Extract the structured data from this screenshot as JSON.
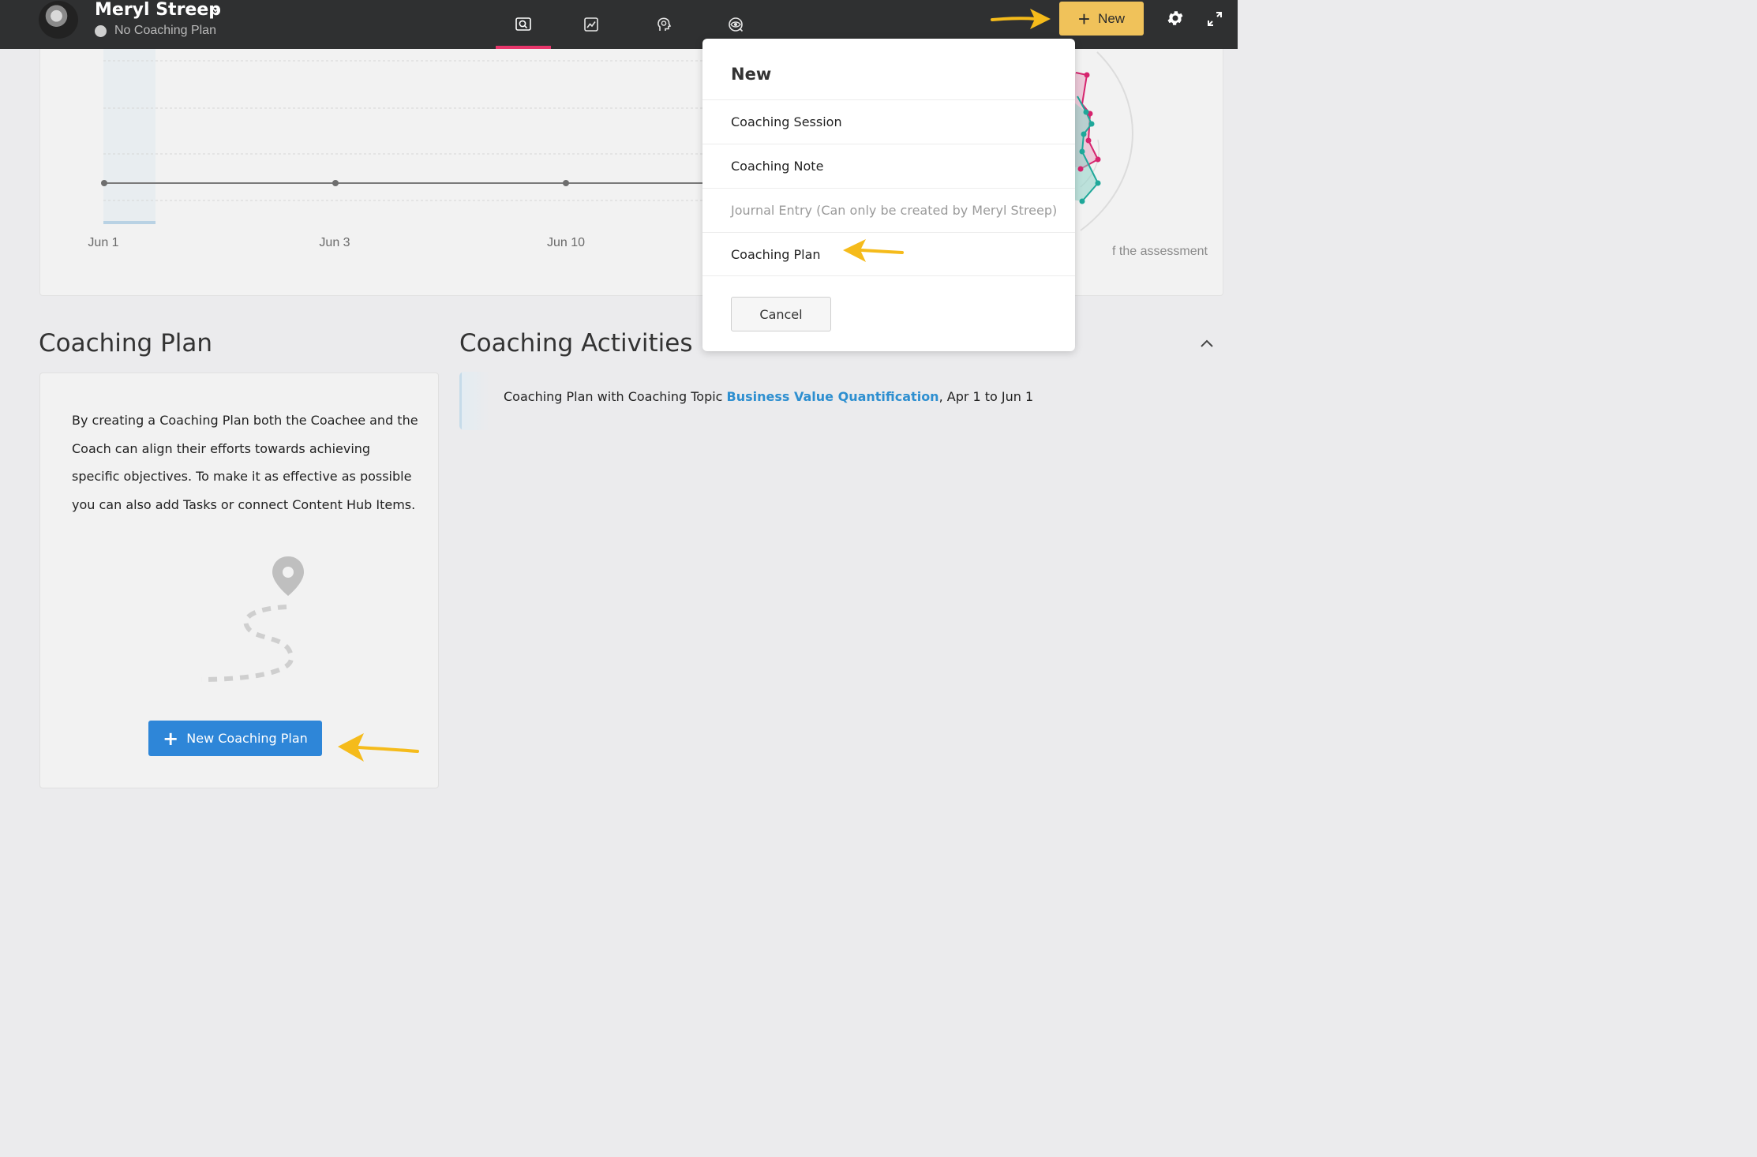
{
  "header": {
    "user_name": "Meryl Streep",
    "plan_status": "No Coaching Plan",
    "new_button_label": "New",
    "nav_tabs": [
      "overview-tab",
      "charts-tab",
      "goals-tab",
      "observe-tab"
    ]
  },
  "chart": {
    "x_labels": [
      "Jun 1",
      "Jun 3",
      "Jun 10"
    ],
    "assessment_caption": "f the assessment"
  },
  "dropdown": {
    "title": "New",
    "items": [
      {
        "label": "Coaching Session",
        "enabled": true
      },
      {
        "label": "Coaching Note",
        "enabled": true
      },
      {
        "label": "Journal Entry (Can only be created by Meryl Streep)",
        "enabled": false
      },
      {
        "label": "Coaching Plan",
        "enabled": true
      }
    ],
    "cancel_label": "Cancel"
  },
  "coaching_plan": {
    "title": "Coaching Plan",
    "description": "By creating a Coaching Plan both the Coachee and the Coach can align their efforts towards achieving specific objectives. To make it as effective as possible you can also add Tasks or connect Content Hub Items.",
    "button_label": "New Coaching Plan"
  },
  "coaching_activities": {
    "title": "Coaching Activities",
    "item": {
      "prefix": "Coaching Plan with Coaching Topic ",
      "topic_link": "Business Value Quantification",
      "suffix": ", Apr 1 to Jun 1"
    }
  },
  "colors": {
    "topbar": "#2f3031",
    "accent_yellow": "#f0c25a",
    "active_tab": "#e8366b",
    "primary_blue": "#2e86d8",
    "link_blue": "#2e8fd0",
    "radar_pink": "#d6246e",
    "radar_teal": "#1fa89a"
  }
}
